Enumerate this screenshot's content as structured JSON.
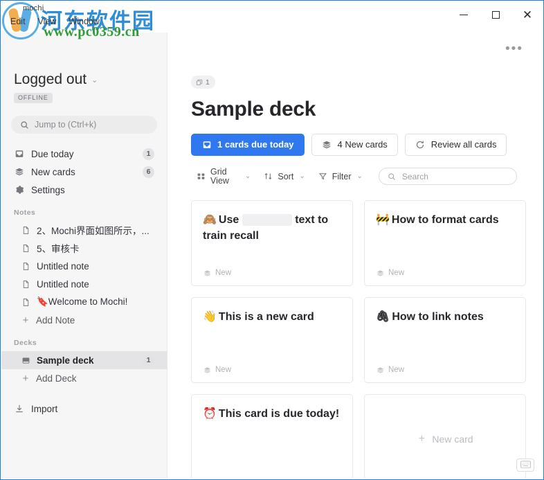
{
  "window": {
    "app_name": "mochi",
    "menus": [
      "Edit",
      "View",
      "Window"
    ],
    "controls": {
      "minimize": "minimize",
      "maximize": "maximize",
      "close": "close"
    },
    "watermark_cn": "河东软件园",
    "watermark_url": "www.pc0359.cn"
  },
  "sidebar": {
    "account_name": "Logged out",
    "status_badge": "OFFLINE",
    "jump_placeholder": "Jump to (Ctrl+k)",
    "nav": [
      {
        "label": "Due today",
        "icon": "inbox-icon",
        "count": "1"
      },
      {
        "label": "New cards",
        "icon": "layers-icon",
        "count": "6"
      },
      {
        "label": "Settings",
        "icon": "gear-icon",
        "count": ""
      }
    ],
    "notes_section": "Notes",
    "notes": [
      {
        "label": "2、Mochi界面如图所示，...",
        "icon": "document-icon"
      },
      {
        "label": "5、审核卡",
        "icon": "document-icon"
      },
      {
        "label": "Untitled note",
        "icon": "document-icon"
      },
      {
        "label": "Untitled note",
        "icon": "document-icon"
      },
      {
        "label": "🔖Welcome to Mochi!",
        "icon": "document-icon"
      }
    ],
    "add_note": "Add Note",
    "decks_section": "Decks",
    "decks": [
      {
        "label": "Sample deck",
        "icon": "deck-icon",
        "count": "1",
        "selected": true
      }
    ],
    "add_deck": "Add Deck",
    "import": "Import"
  },
  "main": {
    "overflow_menu": "•••",
    "deck_card_count": "1",
    "deck_title": "Sample deck",
    "actions": [
      {
        "label": "1 cards due today",
        "icon": "inbox-icon",
        "primary": true
      },
      {
        "label": "4 New cards",
        "icon": "layers-icon",
        "primary": false
      },
      {
        "label": "Review all cards",
        "icon": "refresh-icon",
        "primary": false
      }
    ],
    "toolbar": {
      "view_label": "Grid View",
      "sort_label": "Sort",
      "filter_label": "Filter",
      "search_placeholder": "Search"
    },
    "cards": [
      {
        "emoji": "🙈",
        "title_before": "Use",
        "cloze": true,
        "title_after": "text to train recall",
        "status": "New"
      },
      {
        "emoji": "🚧",
        "title_before": "How to format cards",
        "cloze": false,
        "title_after": "",
        "status": "New"
      },
      {
        "emoji": "👋",
        "title_before": "This is a new card",
        "cloze": false,
        "title_after": "",
        "status": "New"
      },
      {
        "emoji": "🖇",
        "title_before": "How to link notes",
        "cloze": false,
        "title_after": "",
        "status": "New"
      },
      {
        "emoji": "⏰",
        "title_before": "This card is due today!",
        "cloze": false,
        "title_after": "",
        "status": ""
      }
    ],
    "new_card_label": "New card"
  },
  "colors": {
    "accent": "#2f78ef",
    "sidebar_bg": "#f6f6f7",
    "window_border": "#1e7fd4",
    "text_primary": "#26262b",
    "text_muted": "#a0a0a6"
  }
}
